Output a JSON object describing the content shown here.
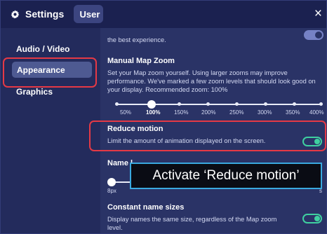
{
  "titlebar": {
    "settings_label": "Settings",
    "user_tab": "User",
    "close": "×"
  },
  "sidebar": {
    "items": [
      {
        "label": "Audio / Video"
      },
      {
        "label": "Appearance"
      },
      {
        "label": "Graphics"
      }
    ]
  },
  "main": {
    "top_fragment": "the best experience.",
    "map_zoom": {
      "title": "Manual Map Zoom",
      "desc": "Set your Map zoom yourself. Using larger zooms may improve performance. We've marked a few zoom levels that should look good on your display. Recommended zoom: 100%",
      "ticks": [
        "50%",
        "100%",
        "150%",
        "200%",
        "250%",
        "300%",
        "350%",
        "400%"
      ],
      "selected": "100%"
    },
    "reduce_motion": {
      "title": "Reduce motion",
      "desc": "Limit the amount of animation displayed on the screen.",
      "enabled": true
    },
    "name_labels": {
      "title_fragment": "Name l",
      "title_fragment2": "s",
      "min_label": "8px"
    },
    "constant_names": {
      "title": "Constant name sizes",
      "desc": "Display names the same size, regardless of the Map zoom level.",
      "enabled": true
    }
  },
  "callout": {
    "text": "Activate ‘Reduce motion’"
  },
  "colors": {
    "accent_toggle": "#3fd0a0",
    "highlight": "#e53945",
    "callout_border": "#3aa9df"
  }
}
